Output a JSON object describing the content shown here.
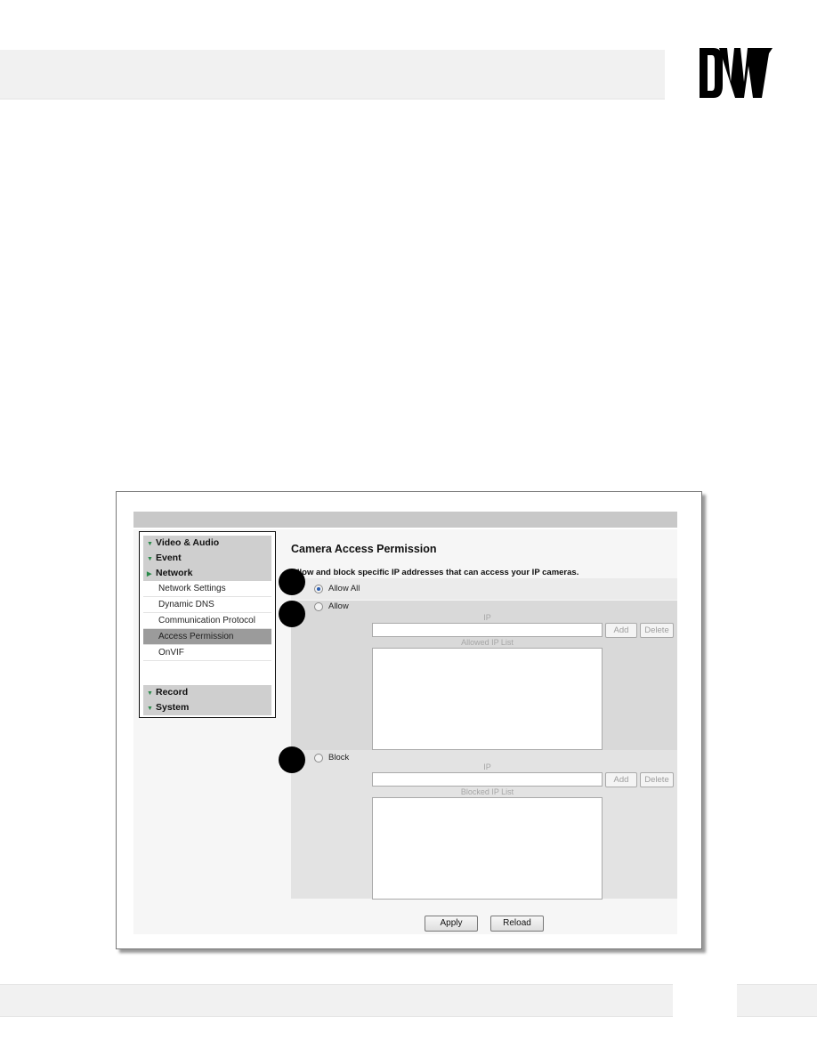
{
  "page": {
    "logo_text": "DW"
  },
  "nav": {
    "groups_top": [
      {
        "label": "Video & Audio",
        "arrow": "▼"
      },
      {
        "label": "Event",
        "arrow": "▼"
      },
      {
        "label": "Network",
        "arrow": "▶"
      }
    ],
    "network_items": [
      {
        "label": "Network Settings",
        "active": false
      },
      {
        "label": "Dynamic DNS",
        "active": false
      },
      {
        "label": "Communication Protocol",
        "active": false
      },
      {
        "label": "Access Permission",
        "active": true
      },
      {
        "label": "OnVIF",
        "active": false
      }
    ],
    "groups_bottom": [
      {
        "label": "Record",
        "arrow": "▼"
      },
      {
        "label": "System",
        "arrow": "▼"
      }
    ]
  },
  "main": {
    "title": "Camera Access Permission",
    "description": "Allow and block specific IP addresses that can access your IP cameras.",
    "options": {
      "allow_all": {
        "label": "Allow All",
        "selected": true
      },
      "allow": {
        "label": "Allow",
        "selected": false
      },
      "block": {
        "label": "Block",
        "selected": false
      }
    },
    "allow_section": {
      "ip_label": "IP",
      "ip_value": "",
      "add_label": "Add",
      "delete_label": "Delete",
      "list_label": "Allowed IP List",
      "list_items": []
    },
    "block_section": {
      "ip_label": "IP",
      "ip_value": "",
      "add_label": "Add",
      "delete_label": "Delete",
      "list_label": "Blocked IP List",
      "list_items": []
    },
    "apply_label": "Apply",
    "reload_label": "Reload"
  },
  "callouts": [
    "callout-1",
    "callout-2",
    "callout-3"
  ]
}
